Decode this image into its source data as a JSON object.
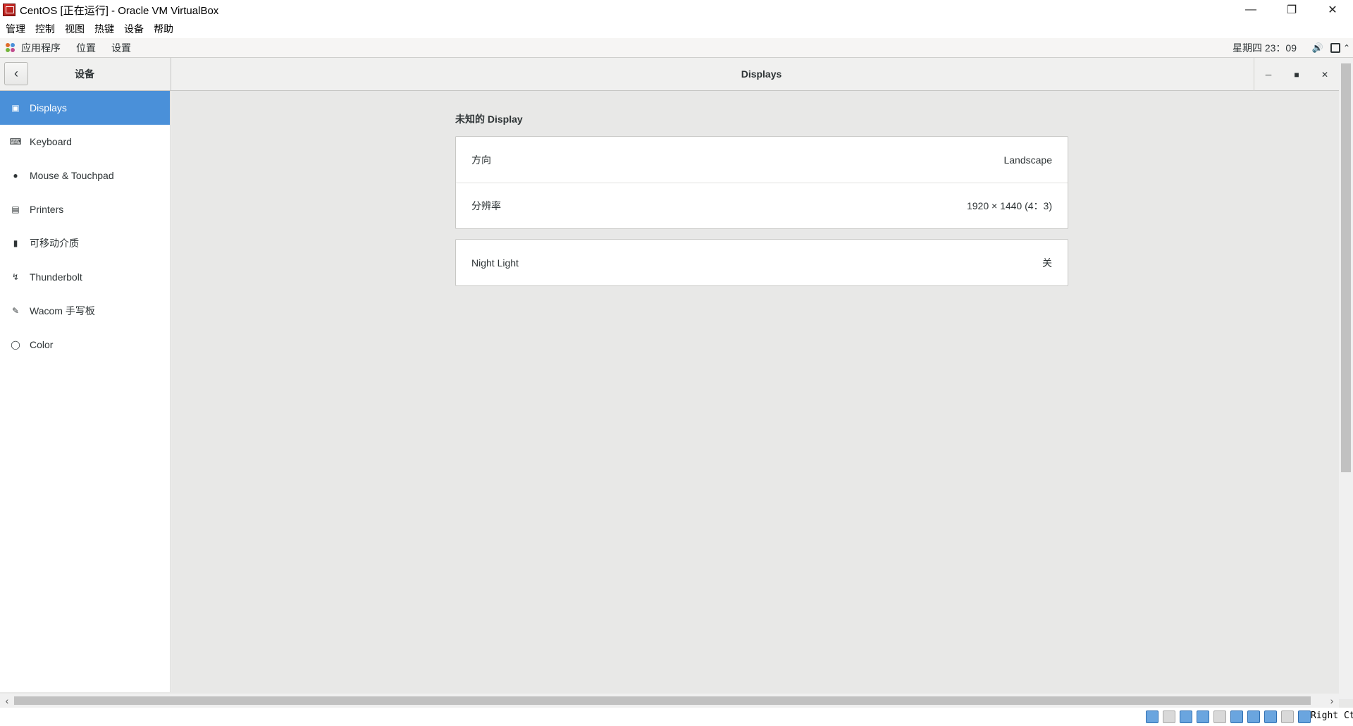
{
  "vbox": {
    "title": "CentOS [正在运行] - Oracle VM VirtualBox",
    "menu": [
      "管理",
      "控制",
      "视图",
      "热键",
      "设备",
      "帮助"
    ],
    "host_key": "Right Ctrl"
  },
  "topbar": {
    "apps": "应用程序",
    "places": "位置",
    "settings": "设置",
    "clock": "星期四 23：09"
  },
  "settings": {
    "sidebar_title": "设备",
    "main_title": "Displays",
    "sidebar": {
      "items": [
        {
          "label": "Displays",
          "icon": "display-icon"
        },
        {
          "label": "Keyboard",
          "icon": "keyboard-icon"
        },
        {
          "label": "Mouse & Touchpad",
          "icon": "mouse-icon"
        },
        {
          "label": "Printers",
          "icon": "printer-icon"
        },
        {
          "label": "可移动介质",
          "icon": "removable-media-icon"
        },
        {
          "label": "Thunderbolt",
          "icon": "thunderbolt-icon"
        },
        {
          "label": "Wacom 手写板",
          "icon": "wacom-tablet-icon"
        },
        {
          "label": "Color",
          "icon": "color-icon"
        }
      ]
    },
    "display": {
      "heading": "未知的  Display",
      "orientation_label": "方向",
      "orientation_value": "Landscape",
      "resolution_label": "分辨率",
      "resolution_value": "1920 × 1440 (4：3)",
      "night_light_label": "Night Light",
      "night_light_value": "关"
    }
  },
  "colors": {
    "selection": "#4a90d9",
    "content_bg": "#e8e8e7"
  }
}
